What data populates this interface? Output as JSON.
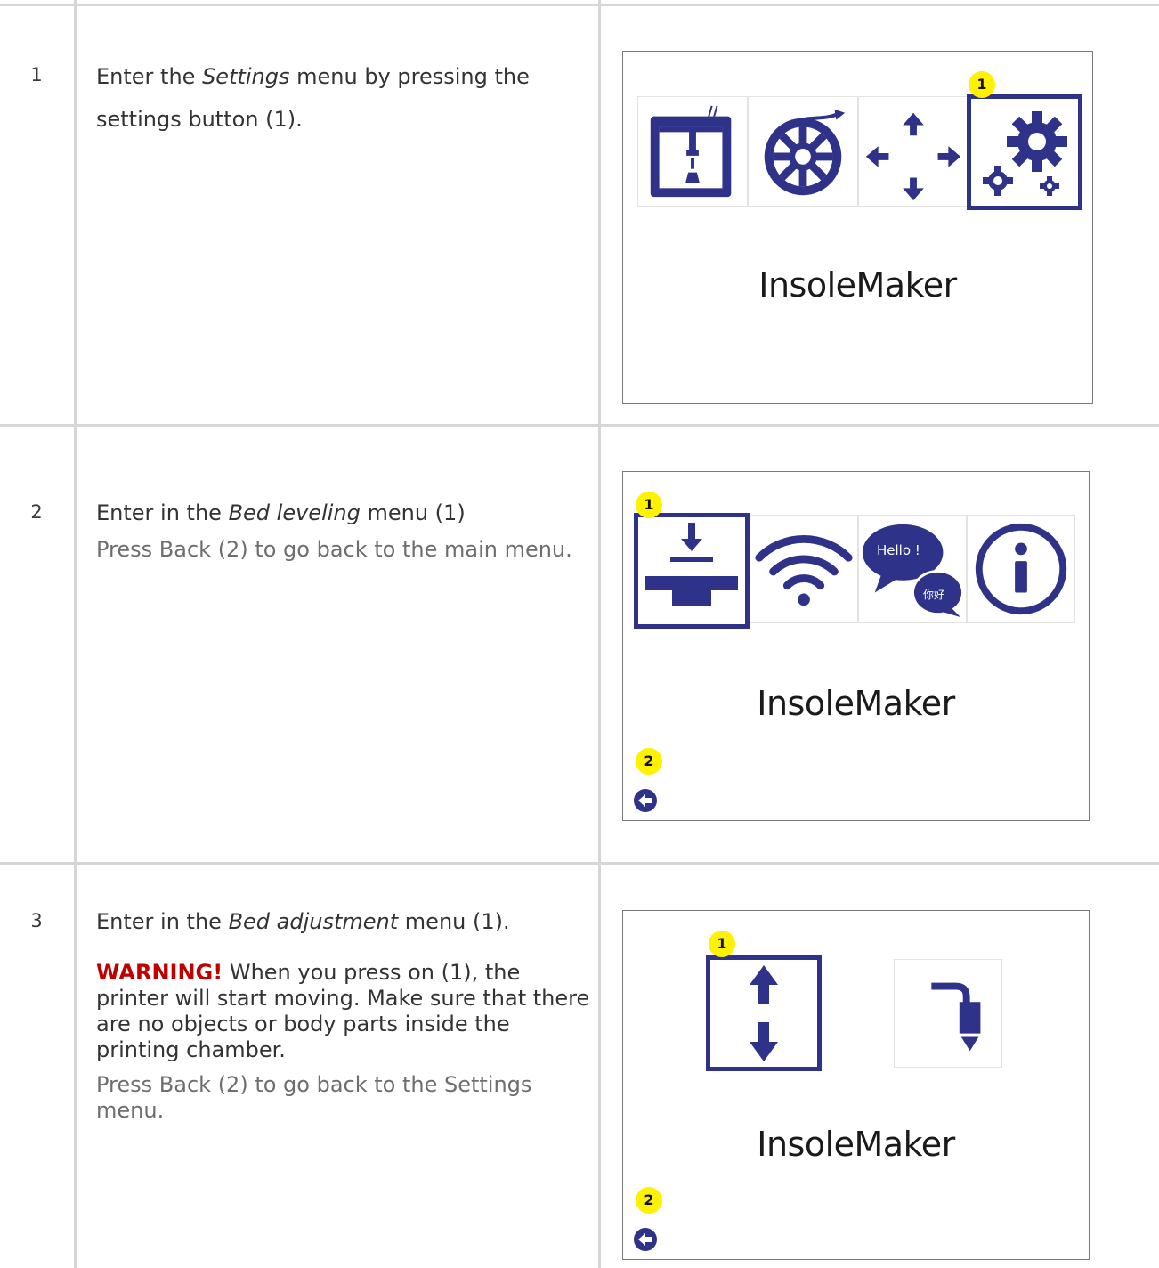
{
  "colors": {
    "icon": "#2e3389",
    "badge": "#fff200",
    "warning": "#c00000",
    "grid": "#d6d6d6"
  },
  "steps": [
    {
      "number": "1",
      "text_before": "Enter the ",
      "text_em": "Settings",
      "text_after": " menu by pressing the settings button (1).",
      "screen": {
        "brand": "InsoleMaker",
        "icons": [
          "printer-icon",
          "filament-spool-icon",
          "move-arrows-icon",
          "settings-gears-icon"
        ],
        "badges": [
          "1"
        ]
      }
    },
    {
      "number": "2",
      "text_before": "Enter in the ",
      "text_em": "Bed leveling",
      "text_after": " menu (1)",
      "note": "Press Back (2) to go back to the main menu.",
      "screen": {
        "brand": "InsoleMaker",
        "icons": [
          "bed-leveling-icon",
          "wifi-icon",
          "language-icon",
          "info-icon"
        ],
        "language_hello": "Hello !",
        "language_chinese": "你好",
        "badges": [
          "1",
          "2"
        ]
      }
    },
    {
      "number": "3",
      "text_before": "Enter in the ",
      "text_em": "Bed adjustment",
      "text_after": " menu (1).",
      "warning_label": "WARNING!",
      "warning_text": " When you press on (1), the printer will start moving. Make sure that there are no objects or body parts inside the printing chamber.",
      "note": "Press Back (2) to go back to the Settings menu.",
      "screen": {
        "brand": "InsoleMaker",
        "icons": [
          "bed-adjust-arrows-icon",
          "extruder-icon"
        ],
        "badges": [
          "1",
          "2"
        ]
      }
    }
  ]
}
